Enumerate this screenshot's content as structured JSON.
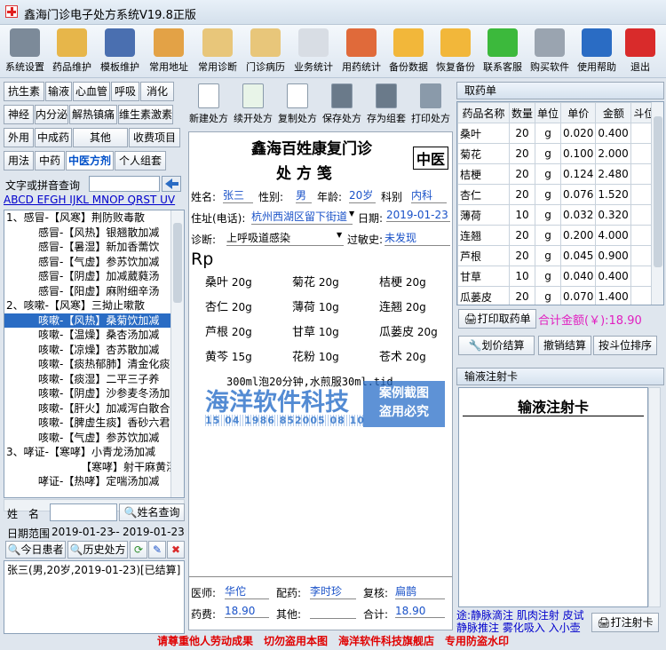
{
  "window": {
    "title": "鑫海门诊电子处方系统V19.8正版"
  },
  "toolbar": [
    {
      "label": "系统设置",
      "icon": "gear-icon",
      "color": "#7c8a99"
    },
    {
      "label": "药品维护",
      "icon": "folder-icon",
      "color": "#e7b64a"
    },
    {
      "label": "模板维护",
      "icon": "book-star-icon",
      "color": "#4a6fb0"
    },
    {
      "label": "常用地址",
      "icon": "map-pin-icon",
      "color": "#e3a246"
    },
    {
      "label": "常用诊断",
      "icon": "clipboard-check-icon",
      "color": "#e8c67a"
    },
    {
      "label": "门诊病历",
      "icon": "clipboard-icon",
      "color": "#e8c67a"
    },
    {
      "label": "业务统计",
      "icon": "line-chart-icon",
      "color": "#d8dde4"
    },
    {
      "label": "用药统计",
      "icon": "pie-chart-icon",
      "color": "#e06a3a"
    },
    {
      "label": "备份数据",
      "icon": "stack-boxes-icon",
      "color": "#f2b73a"
    },
    {
      "label": "恢复备份",
      "icon": "box-icon",
      "color": "#f2b73a"
    },
    {
      "label": "联系客服",
      "icon": "wechat-icon",
      "color": "#3cb93c"
    },
    {
      "label": "购买软件",
      "icon": "shopping-cart-icon",
      "color": "#9aa4b0"
    },
    {
      "label": "使用帮助",
      "icon": "help-icon",
      "color": "#2a6cc4"
    },
    {
      "label": "退出",
      "icon": "exit-icon",
      "color": "#d92b2b"
    }
  ],
  "categories": [
    [
      "抗生素",
      "输液",
      "心血管",
      "呼吸",
      "消化"
    ],
    [
      "神经",
      "内分泌",
      "解热镇痛",
      "维生素激素"
    ],
    [
      "外用",
      "中成药",
      "其他",
      "收费项目"
    ],
    [
      "用法",
      "中药",
      "中医方剂",
      "个人组套"
    ]
  ],
  "search": {
    "label": "文字或拼音查询",
    "alphabet": "ABCD EFGH IJKL MNOP QRST UV"
  },
  "formula_list": [
    "1、感冒-【风寒】荆防败毒散",
    "感冒-【风热】银翘散加减",
    "感冒-【暑湿】新加香薷饮",
    "感冒-【气虚】参苏饮加减",
    "感冒-【阴虚】加减葳蕤汤",
    "感冒-【阳虚】麻附细辛汤",
    "2、咳嗽-【风寒】三拗止嗽散",
    "咳嗽-【风热】桑菊饮加减",
    "咳嗽-【温燥】桑杏汤加减",
    "咳嗽-【凉燥】杏苏散加减",
    "咳嗽-【痰热郁肺】清金化痰",
    "咳嗽-【痰湿】二平三子养",
    "咳嗽-【阴虚】沙参麦冬汤加",
    "咳嗽-【肝火】加减泻白散合",
    "咳嗽-【脾虚生痰】香砂六君",
    "咳嗽-【气虚】参苏饮加减",
    "3、哮证-【寒哮】小青龙汤加减",
    "【寒哮】射干麻黄汤加减",
    "哮证-【热哮】定喘汤加减"
  ],
  "patient_search": {
    "name_label": "姓　名",
    "name_btn": "姓名查询",
    "date_label": "日期范围",
    "date_from": "2019-01-23",
    "date_to": "2019-01-23",
    "today_btn": "今日患者",
    "history_btn": "历史处方",
    "record": "张三(男,20岁,2019-01-23)[已结算]"
  },
  "rx_toolbar": [
    "新建处方",
    "续开处方",
    "复制处方",
    "保存处方",
    "存为组套",
    "打印处方"
  ],
  "rx": {
    "clinic": "鑫海百姓康复门诊",
    "title": "处 方 笺",
    "type": "中医",
    "name_label": "姓名:",
    "name": "张三",
    "sex_label": "性别:",
    "sex": "男",
    "age_label": "年龄:",
    "age": "20岁",
    "dept_label": "科别",
    "dept": "内科",
    "addr_label": "住址(电话):",
    "addr": "杭州西湖区留下街道",
    "date_label": "日期:",
    "date": "2019-01-23",
    "diag_label": "诊断:",
    "diag": "上呼吸道感染",
    "allergy_label": "过敏史:",
    "allergy": "未发现",
    "rp": "Rp",
    "herbs": [
      [
        "桑叶",
        "20g"
      ],
      [
        "菊花",
        "20g"
      ],
      [
        "桔梗",
        "20g"
      ],
      [
        "杏仁",
        "20g"
      ],
      [
        "薄荷",
        "10g"
      ],
      [
        "连翘",
        "20g"
      ],
      [
        "芦根",
        "20g"
      ],
      [
        "甘草",
        "10g"
      ],
      [
        "瓜蒌皮",
        "20g"
      ],
      [
        "黄芩",
        "15g"
      ],
      [
        "花粉",
        "10g"
      ],
      [
        "苍术",
        "20g"
      ]
    ],
    "usage": "300ml泡20分钟,水煎服30ml.tid",
    "doctor_label": "医师:",
    "doctor": "华佗",
    "dispenser_label": "配药:",
    "dispenser": "李时珍",
    "checker_label": "复核:",
    "checker": "扁鹊",
    "fee_label": "药费:",
    "fee": "18.90",
    "other_label": "其他:",
    "other": "",
    "total_label": "合计:",
    "total": "18.90"
  },
  "watermark": {
    "line1": "海洋软件科技",
    "barcode": "15 04 1986 852005 08 10",
    "stamp1": "案例截图",
    "stamp2": "盗用必究"
  },
  "pickup": {
    "title": "取药单",
    "headers": [
      "药品名称",
      "数量",
      "单位",
      "单价",
      "金额",
      "斗位"
    ],
    "rows": [
      [
        "桑叶",
        "20",
        "g",
        "0.020",
        "0.400",
        ""
      ],
      [
        "菊花",
        "20",
        "g",
        "0.100",
        "2.000",
        ""
      ],
      [
        "桔梗",
        "20",
        "g",
        "0.124",
        "2.480",
        ""
      ],
      [
        "杏仁",
        "20",
        "g",
        "0.076",
        "1.520",
        ""
      ],
      [
        "薄荷",
        "10",
        "g",
        "0.032",
        "0.320",
        ""
      ],
      [
        "连翘",
        "20",
        "g",
        "0.200",
        "4.000",
        ""
      ],
      [
        "芦根",
        "20",
        "g",
        "0.045",
        "0.900",
        ""
      ],
      [
        "甘草",
        "10",
        "g",
        "0.040",
        "0.400",
        ""
      ],
      [
        "瓜蒌皮",
        "20",
        "g",
        "0.070",
        "1.400",
        ""
      ]
    ],
    "print_btn": "打印取药单",
    "total_label": "合计金额(￥):",
    "total": "18.90",
    "calc_btn": "划价结算",
    "cancel_btn": "撤销结算",
    "sort_btn": "按斗位排序"
  },
  "infusion": {
    "title": "输液注射卡",
    "card_title": "输液注射卡",
    "footer_text": "途:静脉滴注 肌肉注射 皮试 静脉推注 雾化吸入 入小壶",
    "print_btn": "打注射卡"
  },
  "footer": "请尊重他人劳动成果　切勿盗用本图　海洋软件科技旗舰店　专用防盗水印"
}
